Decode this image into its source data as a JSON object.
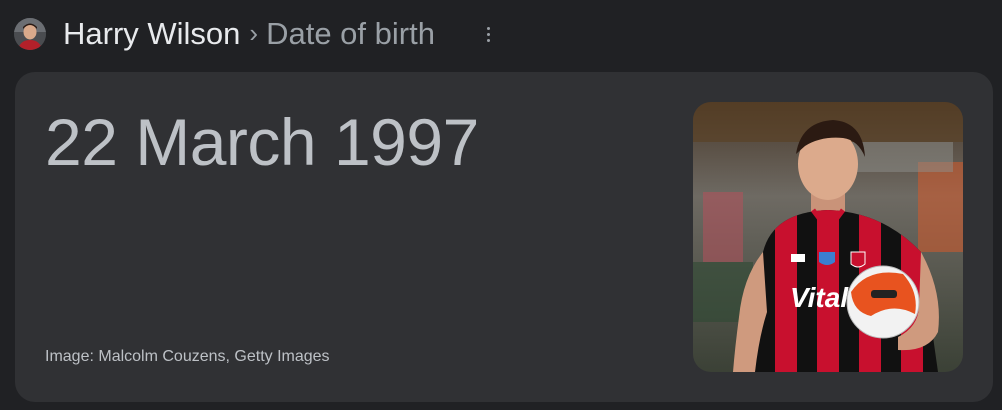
{
  "header": {
    "entity_name": "Harry Wilson",
    "separator": "›",
    "attribute": "Date of birth",
    "avatar_icon": "person-avatar-icon",
    "menu_icon": "more-vert-icon"
  },
  "answer": {
    "value": "22 March 1997"
  },
  "image": {
    "credit": "Image: Malcolm Couzens, Getty Images",
    "shirt_text": "Vitali"
  },
  "colors": {
    "background": "#202124",
    "card": "#303134",
    "title": "#e8eaed",
    "muted": "#9aa0a6",
    "answer": "#bdc1c6",
    "kit_red": "#c8102e",
    "kit_black": "#111111"
  }
}
